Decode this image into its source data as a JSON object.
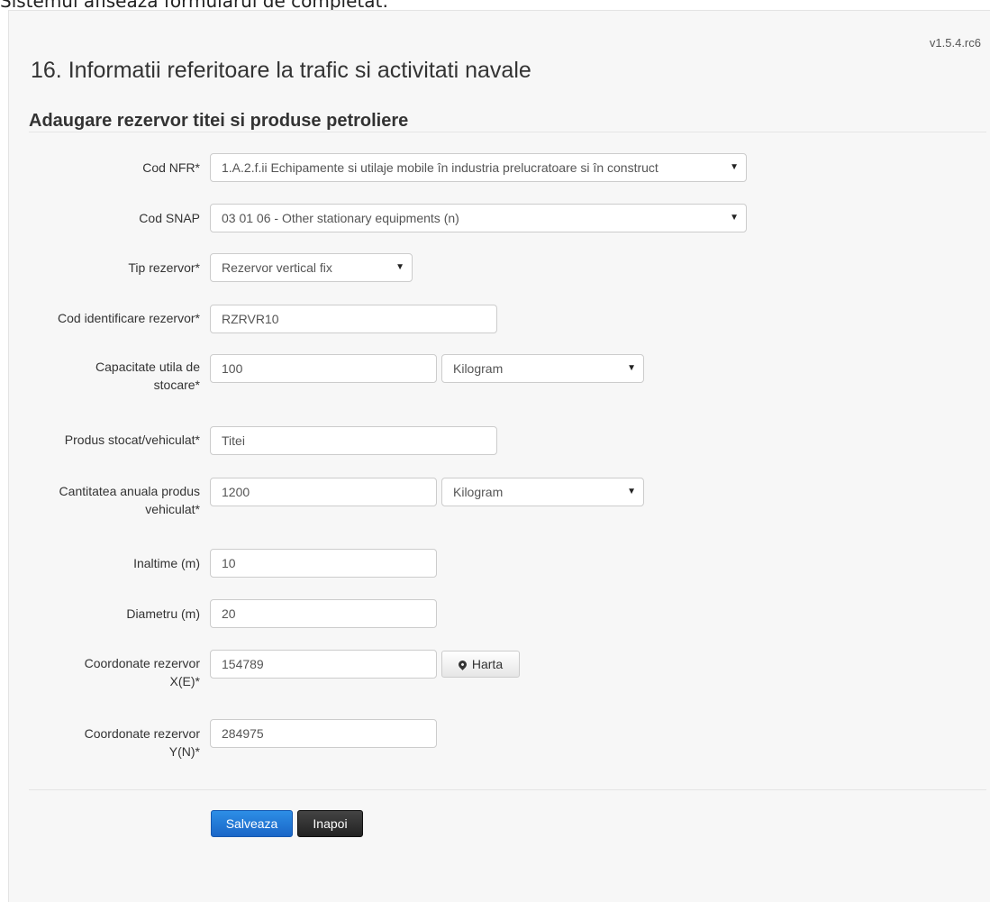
{
  "caption": "Sistemul afiseaza formularul de completat:",
  "version": "v1.5.4.rc6",
  "page_title": "16. Informatii referitoare la trafic si activitati navale",
  "section_title": "Adaugare rezervor titei si produse petroliere",
  "form": {
    "cod_nfr": {
      "label": "Cod NFR*",
      "value": "1.A.2.f.ii Echipamente si utilaje mobile în industria prelucratoare si în construct"
    },
    "cod_snap": {
      "label": "Cod SNAP",
      "value": "03 01 06 - Other stationary equipments (n)"
    },
    "tip_rezervor": {
      "label": "Tip rezervor*",
      "value": "Rezervor vertical fix"
    },
    "cod_identificare": {
      "label": "Cod identificare rezervor*",
      "value": "RZRVR10"
    },
    "capacitate": {
      "label_line1": "Capacitate utila de",
      "label_line2": "stocare*",
      "value": "100",
      "unit": "Kilogram"
    },
    "produs": {
      "label": "Produs stocat/vehiculat*",
      "value": "Titei"
    },
    "cantitate": {
      "label_line1": "Cantitatea anuala produs",
      "label_line2": "vehiculat*",
      "value": "1200",
      "unit": "Kilogram"
    },
    "inaltime": {
      "label": "Inaltime (m)",
      "value": "10"
    },
    "diametru": {
      "label": "Diametru (m)",
      "value": "20"
    },
    "coord_x": {
      "label_line1": "Coordonate rezervor",
      "label_line2": "X(E)*",
      "value": "154789"
    },
    "coord_y": {
      "label_line1": "Coordonate rezervor",
      "label_line2": "Y(N)*",
      "value": "284975"
    }
  },
  "buttons": {
    "map": "Harta",
    "save": "Salveaza",
    "back": "Inapoi"
  },
  "icons": {
    "map_button_icon": "map-marker-icon",
    "select_caret": "caret-down-icon"
  }
}
